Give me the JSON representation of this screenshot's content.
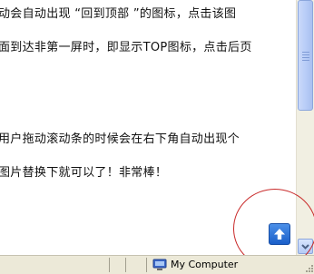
{
  "content": {
    "lines": [
      "动会自动出现 “回到顶部 ”的图标，点击该图",
      "面到达非第一屏时，即显示TOP图标，点击后页",
      "用户拖动滚动条的时候会在右下角自动出现个",
      "图片替换下就可以了！非常棒！"
    ]
  },
  "back_to_top": {
    "icon": "up-arrow-icon",
    "color": "#2a6fd6"
  },
  "annotation": {
    "color": "#c92a2a"
  },
  "statusbar": {
    "zone_label": "My Computer",
    "zone_icon": "computer-icon"
  },
  "scrollbar": {
    "position": 0
  }
}
